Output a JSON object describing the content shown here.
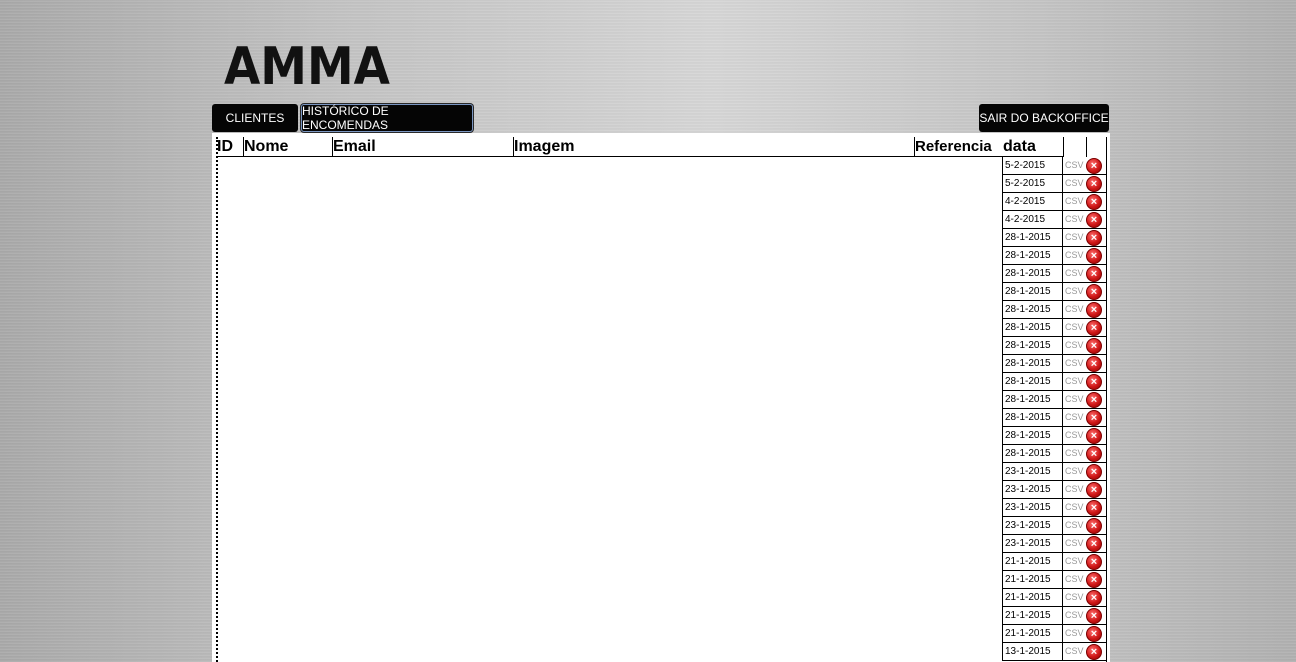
{
  "logo": {
    "text": "AMMA"
  },
  "nav": {
    "clientes": "CLIENTES",
    "historico": "HISTÓRICO DE ENCOMENDAS",
    "sair": "SAIR DO BACKOFFICE"
  },
  "table": {
    "headers": [
      "ID",
      "Nome",
      "Email",
      "Imagem",
      "Referencia",
      "data"
    ],
    "rows": [
      {
        "data": "5-2-2015",
        "csv": "CSV"
      },
      {
        "data": "5-2-2015",
        "csv": "CSV"
      },
      {
        "data": "4-2-2015",
        "csv": "CSV"
      },
      {
        "data": "4-2-2015",
        "csv": "CSV"
      },
      {
        "data": "28-1-2015",
        "csv": "CSV"
      },
      {
        "data": "28-1-2015",
        "csv": "CSV"
      },
      {
        "data": "28-1-2015",
        "csv": "CSV"
      },
      {
        "data": "28-1-2015",
        "csv": "CSV"
      },
      {
        "data": "28-1-2015",
        "csv": "CSV"
      },
      {
        "data": "28-1-2015",
        "csv": "CSV"
      },
      {
        "data": "28-1-2015",
        "csv": "CSV"
      },
      {
        "data": "28-1-2015",
        "csv": "CSV"
      },
      {
        "data": "28-1-2015",
        "csv": "CSV"
      },
      {
        "data": "28-1-2015",
        "csv": "CSV"
      },
      {
        "data": "28-1-2015",
        "csv": "CSV"
      },
      {
        "data": "28-1-2015",
        "csv": "CSV"
      },
      {
        "data": "28-1-2015",
        "csv": "CSV"
      },
      {
        "data": "23-1-2015",
        "csv": "CSV"
      },
      {
        "data": "23-1-2015",
        "csv": "CSV"
      },
      {
        "data": "23-1-2015",
        "csv": "CSV"
      },
      {
        "data": "23-1-2015",
        "csv": "CSV"
      },
      {
        "data": "23-1-2015",
        "csv": "CSV"
      },
      {
        "data": "21-1-2015",
        "csv": "CSV"
      },
      {
        "data": "21-1-2015",
        "csv": "CSV"
      },
      {
        "data": "21-1-2015",
        "csv": "CSV"
      },
      {
        "data": "21-1-2015",
        "csv": "CSV"
      },
      {
        "data": "21-1-2015",
        "csv": "CSV"
      },
      {
        "data": "13-1-2015",
        "csv": "CSV"
      }
    ]
  },
  "icons": {
    "delete": "delete-icon"
  },
  "colors": {
    "nav_bg": "#050505",
    "delete": "#d01818",
    "csv_text": "#999999"
  }
}
